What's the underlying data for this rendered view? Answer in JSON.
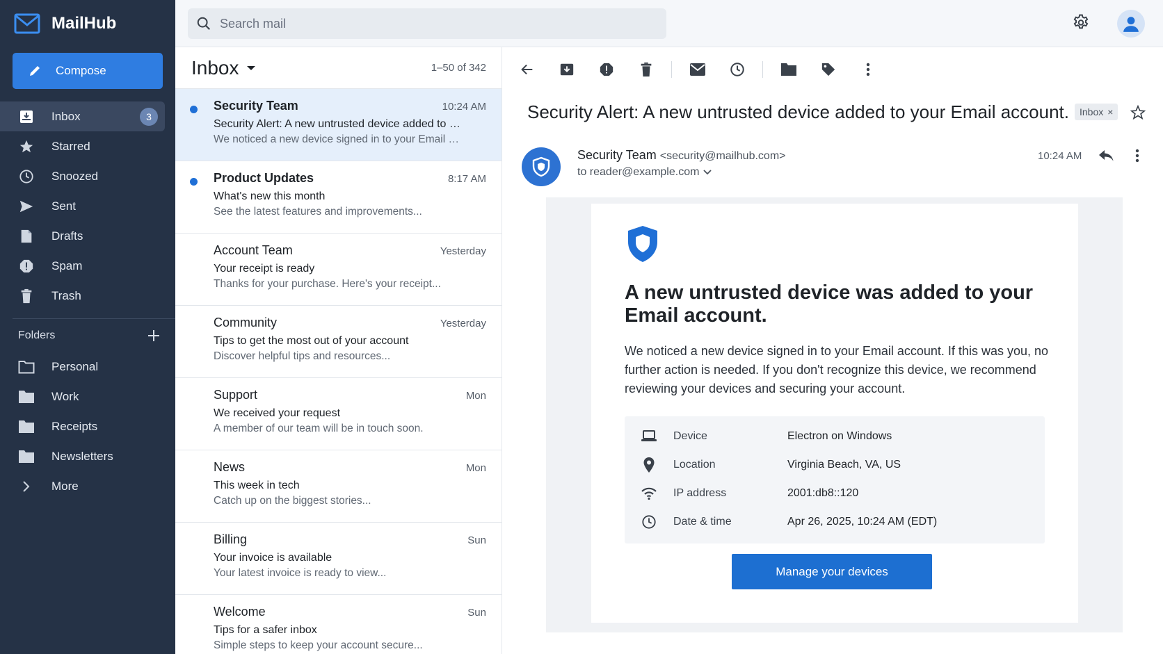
{
  "app": {
    "name": "MailHub"
  },
  "sidebar": {
    "compose_label": "Compose",
    "nav": [
      {
        "label": "Inbox",
        "icon": "inbox-icon",
        "badge": "3",
        "active": true
      },
      {
        "label": "Starred",
        "icon": "star-icon"
      },
      {
        "label": "Snoozed",
        "icon": "clock-icon"
      },
      {
        "label": "Sent",
        "icon": "send-icon"
      },
      {
        "label": "Drafts",
        "icon": "draft-icon"
      },
      {
        "label": "Spam",
        "icon": "spam-icon"
      },
      {
        "label": "Trash",
        "icon": "trash-icon"
      }
    ],
    "folders_label": "Folders",
    "folders": [
      {
        "label": "Personal",
        "icon": "folder-outline-icon"
      },
      {
        "label": "Work",
        "icon": "folder-icon"
      },
      {
        "label": "Receipts",
        "icon": "folder-icon"
      },
      {
        "label": "Newsletters",
        "icon": "folder-icon"
      },
      {
        "label": "More",
        "icon": "chevron-right-icon"
      }
    ]
  },
  "search": {
    "placeholder": "Search mail"
  },
  "list": {
    "title": "Inbox",
    "range": "1–50 of 342",
    "messages": [
      {
        "sender": "Security Team",
        "time": "10:24 AM",
        "subject": "Security Alert: A new untrusted device added to your Email account.",
        "preview": "We noticed a new device signed in to your Email account.",
        "unread": true,
        "selected": true
      },
      {
        "sender": "Product Updates",
        "time": "8:17 AM",
        "subject": "What's new this month",
        "preview": "See the latest features and improvements...",
        "unread": true
      },
      {
        "sender": "Account Team",
        "time": "Yesterday",
        "subject": "Your receipt is ready",
        "preview": "Thanks for your purchase. Here's your receipt..."
      },
      {
        "sender": "Community",
        "time": "Yesterday",
        "subject": "Tips to get the most out of your account",
        "preview": "Discover helpful tips and resources..."
      },
      {
        "sender": "Support",
        "time": "Mon",
        "subject": "We received your request",
        "preview": "A member of our team will be in touch soon."
      },
      {
        "sender": "News",
        "time": "Mon",
        "subject": "This week in tech",
        "preview": "Catch up on the biggest stories..."
      },
      {
        "sender": "Billing",
        "time": "Sun",
        "subject": "Your invoice is available",
        "preview": "Your latest invoice is ready to view..."
      },
      {
        "sender": "Welcome",
        "time": "Sun",
        "subject": "Tips for a safer inbox",
        "preview": "Simple steps to keep your account secure..."
      }
    ]
  },
  "message": {
    "subject": "Security Alert: A new untrusted device added to your Email account.",
    "label_chip": "Inbox",
    "sender_name": "Security Team",
    "sender_email": "<security@mailhub.com>",
    "to": "to reader@example.com",
    "time": "10:24 AM",
    "heading": "A new untrusted device was added to your Email account.",
    "paragraph": "We noticed a new device signed in to your Email account. If this was you, no further action is needed. If you don't recognize this device, we recommend reviewing your devices and securing your account.",
    "details": [
      {
        "icon": "laptop-icon",
        "label": "Device",
        "value": "Electron on Windows"
      },
      {
        "icon": "location-pin-icon",
        "label": "Location",
        "value": "Virginia Beach, VA, US"
      },
      {
        "icon": "wifi-icon",
        "label": "IP address",
        "value": "2001:db8::120"
      },
      {
        "icon": "clock-icon",
        "label": "Date & time",
        "value": "Apr 26, 2025, 10:24 AM (EDT)"
      }
    ],
    "button_label": "Manage your devices"
  },
  "colors": {
    "sidebar": "#253246",
    "accent": "#2f7de1",
    "button": "#1d6fd1",
    "selected_row": "#e5effb",
    "unread_dot": "#1f6fd6"
  }
}
